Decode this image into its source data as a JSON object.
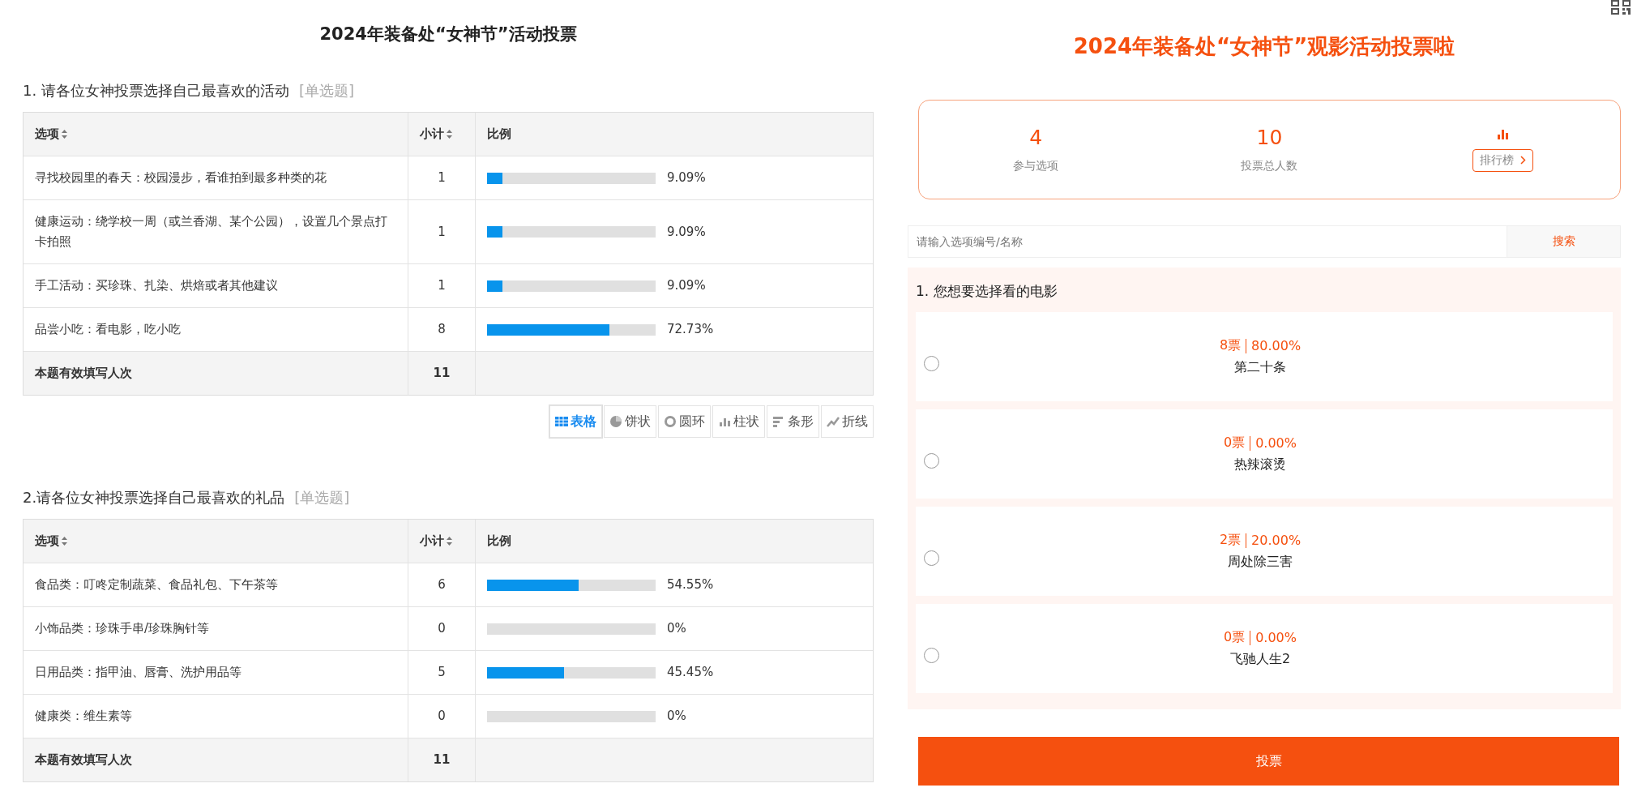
{
  "report": {
    "title": "2024年装备处“女神节”活动投票",
    "questions": [
      {
        "title": "1. 请各位女神投票选择自己最喜欢的活动",
        "tag": "[单选题]",
        "columns": [
          {
            "label": "选项",
            "sortable": true
          },
          {
            "label": "小计",
            "sortable": true
          },
          {
            "label": "比例",
            "sortable": false
          }
        ],
        "rows": [
          {
            "option": "寻找校园里的春天：校园漫步，看谁拍到最多种类的花",
            "count": "1",
            "percent": "9.09%",
            "level": 0.0909
          },
          {
            "option": "健康运动：绕学校一周（或兰香湖、某个公园），设置几个景点打卡拍照",
            "count": "1",
            "percent": "9.09%",
            "level": 0.0909
          },
          {
            "option": "手工活动：买珍珠、扎染、烘焙或者其他建议",
            "count": "1",
            "percent": "9.09%",
            "level": 0.0909
          },
          {
            "option": "品尝小吃：看电影，吃小吃",
            "count": "8",
            "percent": "72.73%",
            "level": 0.7273
          }
        ],
        "footer": {
          "label": "本题有效填写人次",
          "count": "11"
        },
        "views": [
          {
            "kind": "table",
            "label": "表格",
            "selected": true
          },
          {
            "kind": "pie",
            "label": "饼状",
            "selected": false
          },
          {
            "kind": "donut",
            "label": "圆环",
            "selected": false
          },
          {
            "kind": "column",
            "label": "柱状",
            "selected": false
          },
          {
            "kind": "bar",
            "label": "条形",
            "selected": false
          },
          {
            "kind": "line",
            "label": "折线",
            "selected": false
          }
        ]
      },
      {
        "title": "2.请各位女神投票选择自己最喜欢的礼品",
        "tag": "[单选题]",
        "columns": [
          {
            "label": "选项",
            "sortable": true
          },
          {
            "label": "小计",
            "sortable": true
          },
          {
            "label": "比例",
            "sortable": false
          }
        ],
        "rows": [
          {
            "option": "食品类：叮咚定制蔬菜、食品礼包、下午茶等",
            "count": "6",
            "percent": "54.55%",
            "level": 0.5455
          },
          {
            "option": "小饰品类：珍珠手串/珍珠胸针等",
            "count": "0",
            "percent": "0%",
            "level": 0
          },
          {
            "option": "日用品类：指甲油、唇膏、洗护用品等",
            "count": "5",
            "percent": "45.45%",
            "level": 0.4545
          },
          {
            "option": "健康类：维生素等",
            "count": "0",
            "percent": "0%",
            "level": 0
          }
        ],
        "footer": {
          "label": "本题有效填写人次",
          "count": "11"
        }
      }
    ]
  },
  "vote": {
    "title": "2024年装备处“女神节”观影活动投票啦",
    "stats": [
      {
        "value": "4",
        "label": "参与选项"
      },
      {
        "value": "10",
        "label": "投票总人数"
      }
    ],
    "ranking": {
      "label": "排行榜"
    },
    "search": {
      "placeholder": "请输入选项编号/名称",
      "button": "搜索"
    },
    "question": {
      "title": "1. 您想要选择看的电影",
      "options": [
        {
          "votes": "8票",
          "percent": "80.00%",
          "name": "第二十条",
          "selected": false
        },
        {
          "votes": "0票",
          "percent": "0.00%",
          "name": "热辣滚烫",
          "selected": false
        },
        {
          "votes": "2票",
          "percent": "20.00%",
          "name": "周处除三害",
          "selected": false
        },
        {
          "votes": "0票",
          "percent": "0.00%",
          "name": "飞驰人生2",
          "selected": false
        }
      ]
    },
    "submit": "投票"
  }
}
